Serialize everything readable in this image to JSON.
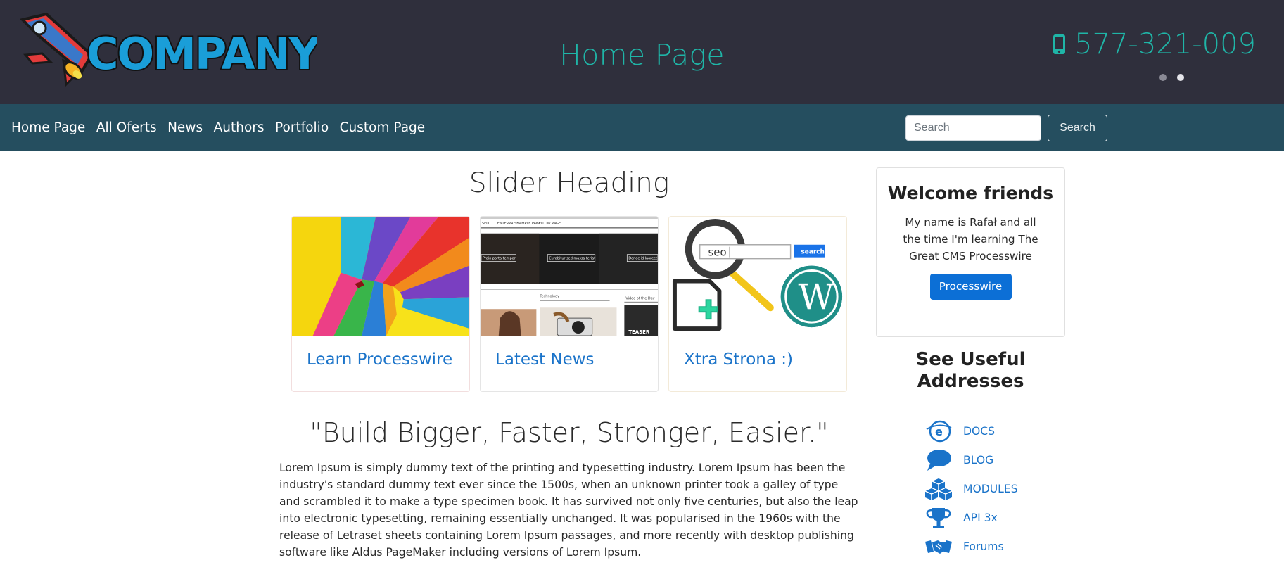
{
  "header": {
    "logo_text": "COMPANY",
    "page_title": "Home Page",
    "phone": "577-321-009",
    "carousel_dots": 2
  },
  "nav": {
    "items": [
      "Home Page",
      "All Oferts",
      "News",
      "Authors",
      "Portfolio",
      "Custom Page"
    ],
    "search_placeholder": "Search",
    "search_button": "Search"
  },
  "main": {
    "slider_heading": "Slider Heading",
    "cards": [
      {
        "title": "Learn Processwire"
      },
      {
        "title": "Latest News"
      },
      {
        "title": "Xtra Strona :)"
      }
    ],
    "card2_image_text": {
      "menu": [
        "SEO",
        "ENTERPRISE",
        "SAMPLE PAGE",
        "YELLOW PAGE"
      ],
      "banners": [
        "Proin porta tempor",
        "Curabitur sed massa feriat",
        "Donec id laoreet"
      ],
      "section": "Technology",
      "side": "Video of the Day",
      "teaser": "TEASER"
    },
    "card3_image_text": {
      "search_value": "seo",
      "search_button": "search"
    },
    "quote": "\"Build Bigger, Faster, Stronger, Easier.\"",
    "body_text": "Lorem Ipsum is simply dummy text of the printing and typesetting industry. Lorem Ipsum has been the industry's standard dummy text ever since the 1500s, when an unknown printer took a galley of type and scrambled it to make a type specimen book. It has survived not only five centuries, but also the leap into electronic typesetting, remaining essentially unchanged. It was popularised in the 1960s with the release of Letraset sheets containing Lorem Ipsum passages, and more recently with desktop publishing software like Aldus PageMaker including versions of Lorem Ipsum."
  },
  "sidebar": {
    "welcome_title": "Welcome friends",
    "welcome_text": "My name is Rafał and all the time I'm learning The Great CMS Processwire",
    "welcome_button": "Processwire",
    "useful_title": "See Useful Addresses",
    "links": [
      {
        "label": "DOCS",
        "icon": "docs-icon"
      },
      {
        "label": "BLOG",
        "icon": "blog-icon"
      },
      {
        "label": "MODULES",
        "icon": "modules-icon"
      },
      {
        "label": "API 3x",
        "icon": "trophy-icon"
      },
      {
        "label": "Forums",
        "icon": "handshake-icon"
      }
    ]
  },
  "colors": {
    "header_bg": "#2f2f3c",
    "accent_teal": "#1fb5a7",
    "navbar_bg": "#254e5f",
    "link_blue": "#1a73c9",
    "button_blue": "#0c6fd6"
  }
}
